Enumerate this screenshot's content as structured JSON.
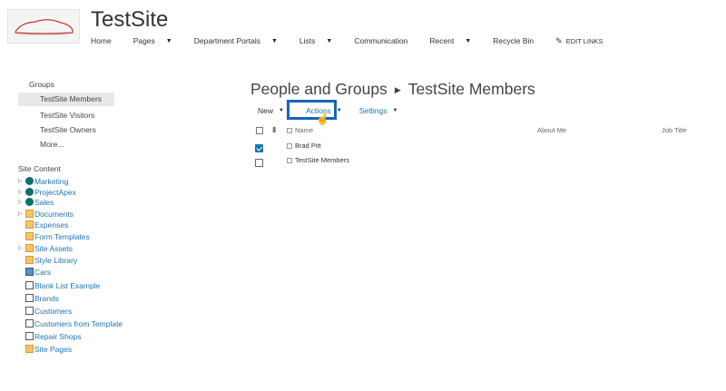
{
  "site": {
    "title": "TestSite"
  },
  "topnav": {
    "items": [
      {
        "label": "Home",
        "has_menu": false
      },
      {
        "label": "Pages",
        "has_menu": true
      },
      {
        "label": "Department Portals",
        "has_menu": true
      },
      {
        "label": "Lists",
        "has_menu": true
      },
      {
        "label": "Communication",
        "has_menu": false
      },
      {
        "label": "Recent",
        "has_menu": true
      },
      {
        "label": "Recycle Bin",
        "has_menu": false
      }
    ],
    "edit_links": "EDIT LINKS"
  },
  "leftnav": {
    "groups_heading": "Groups",
    "groups": [
      {
        "label": "TestSite Members",
        "selected": true
      },
      {
        "label": "TestSite Visitors",
        "selected": false
      },
      {
        "label": "TestSite Owners",
        "selected": false
      },
      {
        "label": "More...",
        "selected": false
      }
    ],
    "site_content_heading": "Site Content",
    "site_content": [
      {
        "label": "Marketing",
        "icon": "subsite-icon",
        "expandable": true
      },
      {
        "label": "ProjectApex",
        "icon": "subsite-icon",
        "expandable": true
      },
      {
        "label": "Sales",
        "icon": "subsite-icon",
        "expandable": true
      },
      {
        "label": "Documents",
        "icon": "library-icon",
        "expandable": true
      },
      {
        "label": "Expenses",
        "icon": "library-icon",
        "expandable": false
      },
      {
        "label": "Form Templates",
        "icon": "library-icon",
        "expandable": false
      },
      {
        "label": "Site Assets",
        "icon": "library-icon",
        "expandable": true
      },
      {
        "label": "Style Library",
        "icon": "library-icon",
        "expandable": false
      },
      {
        "label": "Cars",
        "icon": "picture-library-icon",
        "expandable": false
      },
      {
        "label": "Blank List Example",
        "icon": "list-icon",
        "expandable": false
      },
      {
        "label": "Brands",
        "icon": "list-icon",
        "expandable": false
      },
      {
        "label": "Customers",
        "icon": "list-icon",
        "expandable": false
      },
      {
        "label": "Customers from Template",
        "icon": "list-icon",
        "expandable": false
      },
      {
        "label": "Repair Shops",
        "icon": "list-icon",
        "expandable": false
      },
      {
        "label": "Site Pages",
        "icon": "library-icon",
        "expandable": false
      }
    ]
  },
  "main": {
    "breadcrumb_root": "People and Groups",
    "breadcrumb_current": "TestSite Members",
    "toolbar": {
      "new": "New",
      "actions": "Actions",
      "settings": "Settings"
    },
    "columns": {
      "name": "Name",
      "about": "About Me",
      "job": "Job Title"
    },
    "rows": [
      {
        "name": "Brad Pitt",
        "checked": true
      },
      {
        "name": "TestSite Members",
        "checked": false
      }
    ]
  },
  "colors": {
    "link": "#1a76b5",
    "highlight_box": "#1565b8",
    "selected_bg": "#e8e8e8"
  }
}
